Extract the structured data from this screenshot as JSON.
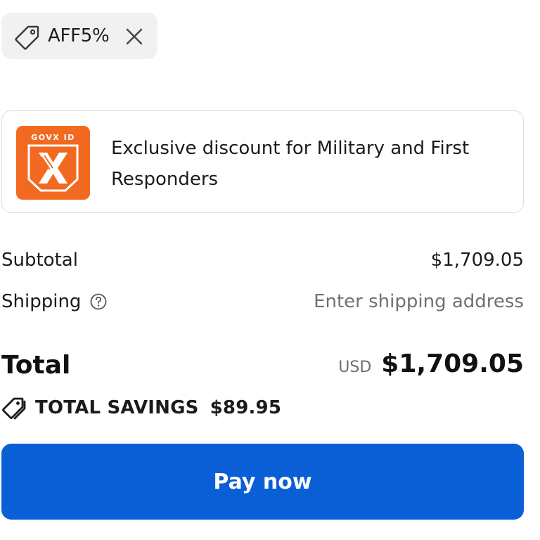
{
  "discount_chip": {
    "code": "AFF5%",
    "tag_icon": "tag-icon",
    "remove_icon": "close-icon"
  },
  "military_card": {
    "logo_text": "GOVX ID",
    "logo_letter": "X",
    "message": "Exclusive discount for Military and First Responders",
    "logo_color": "#f26a21"
  },
  "summary": {
    "subtotal_label": "Subtotal",
    "subtotal_value": "$1,709.05",
    "shipping_label": "Shipping",
    "shipping_help_icon": "help-circle-icon",
    "shipping_value": "Enter shipping address"
  },
  "total": {
    "label": "Total",
    "currency": "USD",
    "amount": "$1,709.05"
  },
  "savings": {
    "icon": "tags-icon",
    "label": "TOTAL SAVINGS",
    "amount": "$89.95"
  },
  "pay_button": {
    "label": "Pay now",
    "color": "#0a5fd6"
  }
}
